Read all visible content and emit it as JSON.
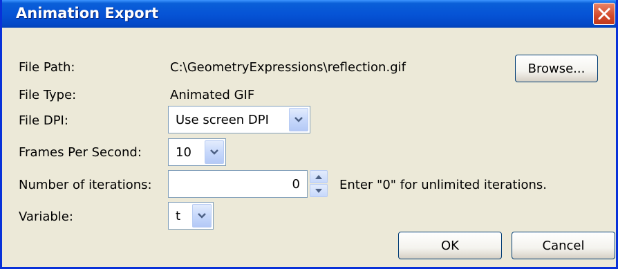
{
  "window": {
    "title": "Animation Export"
  },
  "fields": {
    "file_path": {
      "label": "File Path:",
      "value": "C:\\GeometryExpressions\\reflection.gif"
    },
    "file_type": {
      "label": "File Type:",
      "value": "Animated GIF"
    },
    "file_dpi": {
      "label": "File DPI:",
      "value": "Use screen DPI"
    },
    "fps": {
      "label": "Frames Per Second:",
      "value": "10"
    },
    "iterations": {
      "label": "Number of iterations:",
      "value": "0",
      "hint": "Enter \"0\" for unlimited iterations."
    },
    "variable": {
      "label": "Variable:",
      "value": "t"
    }
  },
  "buttons": {
    "browse": "Browse...",
    "ok": "OK",
    "cancel": "Cancel"
  },
  "icons": {
    "close": "close-icon",
    "dropdown": "chevron-down-icon",
    "spin_up": "arrow-up-icon",
    "spin_down": "arrow-down-icon"
  },
  "colors": {
    "titlebar": "#0654d6",
    "window_bg": "#ece9d8",
    "close": "#d2492a",
    "button_border": "#003c74"
  }
}
